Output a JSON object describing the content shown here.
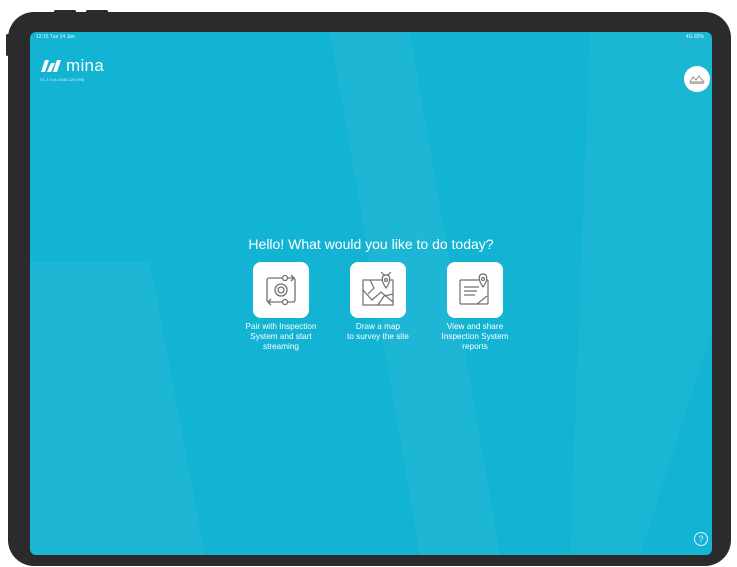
{
  "status_bar": {
    "time_date": "12:15  Tue 14 Jan",
    "indicators": "4G 82%"
  },
  "app": {
    "name": "mina",
    "version": "V1.7.0 (4.0/169.229.990)"
  },
  "headline": "Hello! What would you like to do today?",
  "actions": [
    {
      "label": "Pair with Inspection\nSystem and start\nstreaming",
      "icon": "pair-stream-icon"
    },
    {
      "label": "Draw a map\nto survey the site",
      "icon": "map-pin-icon"
    },
    {
      "label": "View and share\nInspection System\nreports",
      "icon": "report-pin-icon"
    }
  ],
  "help": {
    "symbol": "?"
  },
  "colors": {
    "background": "#12b3d3",
    "tile": "#ffffff",
    "frame": "#2b2b2d",
    "text": "#ffffff"
  }
}
